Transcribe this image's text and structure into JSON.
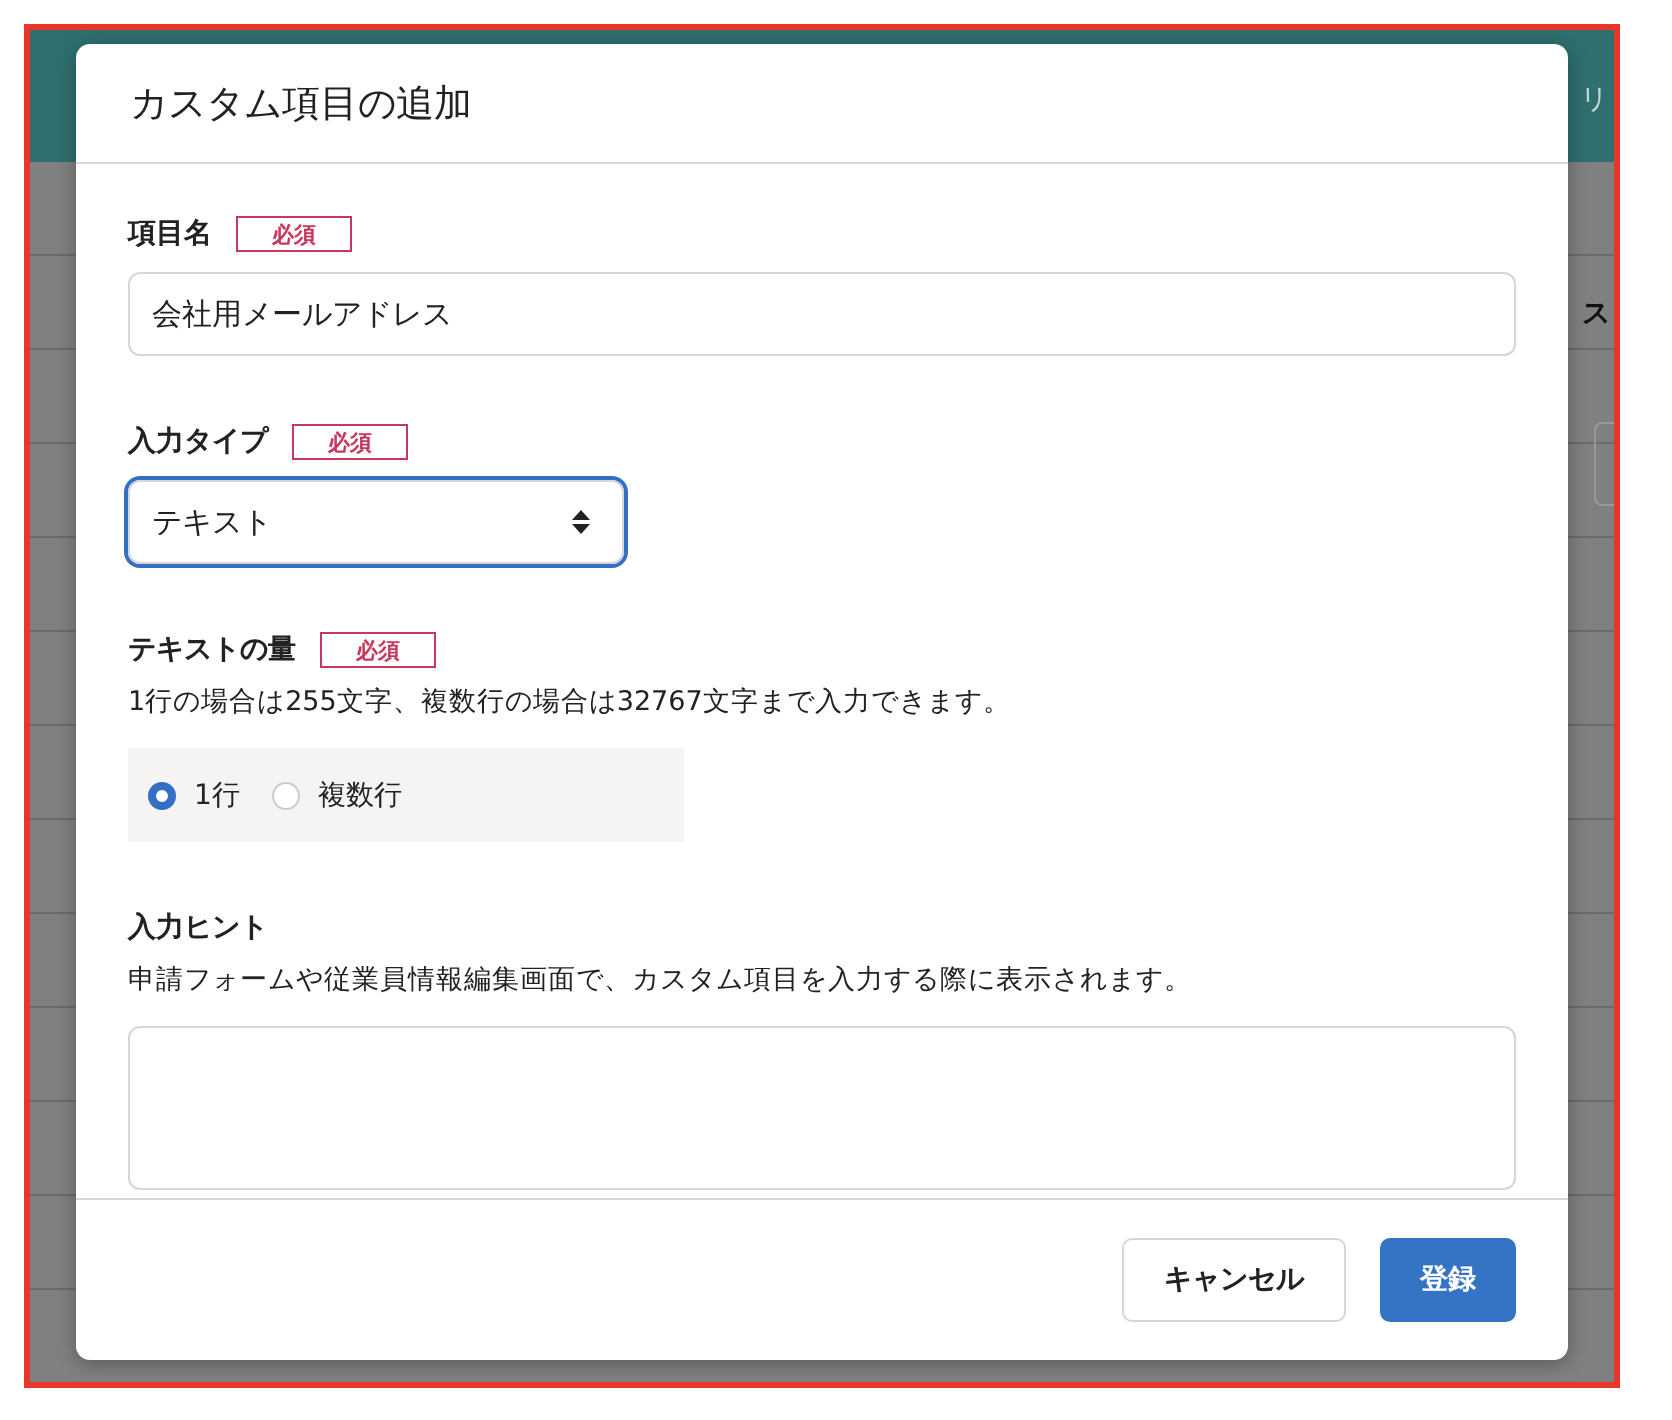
{
  "background": {
    "header_text": "リ",
    "column_text": "ス"
  },
  "dialog": {
    "title": "カスタム項目の追加",
    "fields": [
      {
        "kind": "text",
        "label": "項目名",
        "badge": "必須",
        "value": "会社用メールアドレス"
      },
      {
        "kind": "select",
        "label": "入力タイプ",
        "badge": "必須",
        "value": "テキスト",
        "focused": true
      },
      {
        "kind": "radio",
        "label": "テキストの量",
        "badge": "必須",
        "help": "1行の場合は255文字、複数行の場合は32767文字まで入力できます。",
        "options": [
          {
            "label": "1行",
            "selected": true
          },
          {
            "label": "複数行",
            "selected": false
          }
        ]
      },
      {
        "kind": "textarea",
        "label": "入力ヒント",
        "help": "申請フォームや従業員情報編集画面で、カスタム項目を入力する際に表示されます。"
      }
    ],
    "buttons": [
      {
        "label": "キャンセル",
        "kind": "secondary"
      },
      {
        "label": "登録",
        "kind": "primary"
      }
    ]
  }
}
